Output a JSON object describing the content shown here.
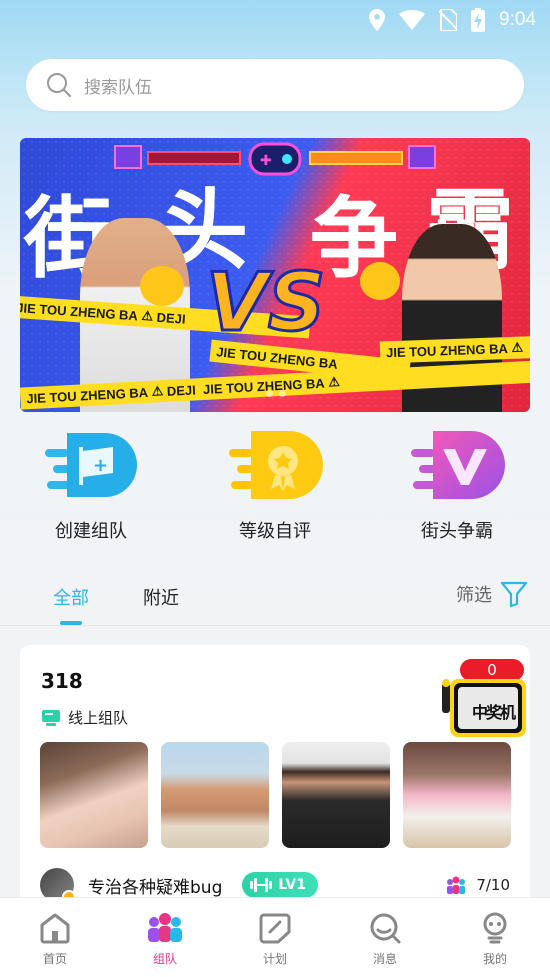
{
  "status_bar": {
    "time": "9:04"
  },
  "search": {
    "placeholder": "搜索队伍"
  },
  "banner": {
    "chars": [
      "街",
      "头",
      "争",
      "霸"
    ],
    "vs": "VS",
    "tape_text": "JIE TOU ZHENG BA",
    "tape_tag": "DEJI"
  },
  "quick_actions": [
    {
      "label": "创建组队",
      "icon": "create-team-flag-icon"
    },
    {
      "label": "等级自评",
      "icon": "level-medal-icon"
    },
    {
      "label": "街头争霸",
      "icon": "street-battle-v-icon"
    }
  ],
  "tabs": {
    "all": "全部",
    "nearby": "附近",
    "filter": "筛选"
  },
  "card": {
    "title": "318",
    "team_type": "线上组队",
    "badge_count": "0",
    "badge_text": "中奖机",
    "owner_name": "专治各种疑难bug",
    "level": "LV1",
    "members": "7/10"
  },
  "nav": [
    {
      "label": "首页",
      "icon": "home-icon",
      "active": false
    },
    {
      "label": "组队",
      "icon": "team-icon",
      "active": true
    },
    {
      "label": "计划",
      "icon": "plan-icon",
      "active": false
    },
    {
      "label": "消息",
      "icon": "message-icon",
      "active": false
    },
    {
      "label": "我的",
      "icon": "profile-icon",
      "active": false
    }
  ],
  "colors": {
    "accent": "#2bb7e8",
    "nav_active": "#e83585",
    "level_badge": "#2ed1a5",
    "badge_red": "#ea1c2a"
  }
}
